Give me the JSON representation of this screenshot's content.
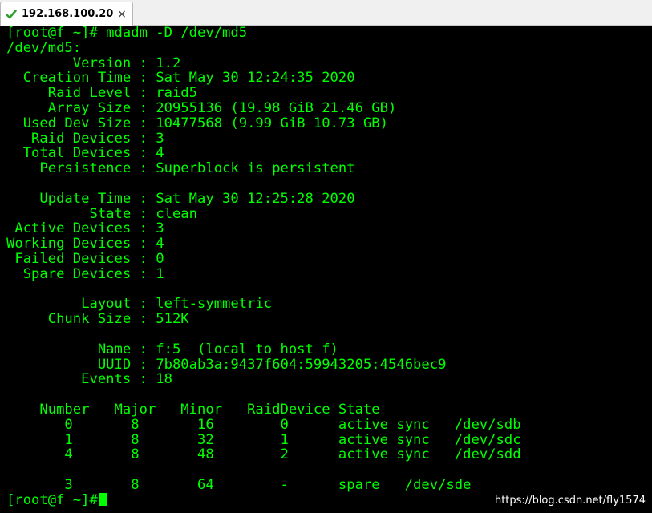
{
  "tab": {
    "title": "192.168.100.20",
    "close_glyph": "×",
    "icon": "checkmark-icon",
    "icon_color": "#2e9e2e"
  },
  "terminal": {
    "colors": {
      "background": "#000000",
      "text": "#00ff00"
    },
    "lines": [
      "[root@f ~]# mdadm -D /dev/md5",
      "/dev/md5:",
      "        Version : 1.2",
      "  Creation Time : Sat May 30 12:24:35 2020",
      "     Raid Level : raid5",
      "     Array Size : 20955136 (19.98 GiB 21.46 GB)",
      "  Used Dev Size : 10477568 (9.99 GiB 10.73 GB)",
      "   Raid Devices : 3",
      "  Total Devices : 4",
      "    Persistence : Superblock is persistent",
      "",
      "    Update Time : Sat May 30 12:25:28 2020",
      "          State : clean",
      " Active Devices : 3",
      "Working Devices : 4",
      " Failed Devices : 0",
      "  Spare Devices : 1",
      "",
      "         Layout : left-symmetric",
      "     Chunk Size : 512K",
      "",
      "           Name : f:5  (local to host f)",
      "           UUID : 7b80ab3a:9437f604:59943205:4546bec9",
      "         Events : 18",
      "",
      "    Number   Major   Minor   RaidDevice State",
      "       0       8       16        0      active sync   /dev/sdb",
      "       1       8       32        1      active sync   /dev/sdc",
      "       4       8       48        2      active sync   /dev/sdd",
      "",
      "       3       8       64        -      spare   /dev/sde",
      "[root@f ~]#"
    ]
  },
  "watermark": "https://blog.csdn.net/fly1574"
}
